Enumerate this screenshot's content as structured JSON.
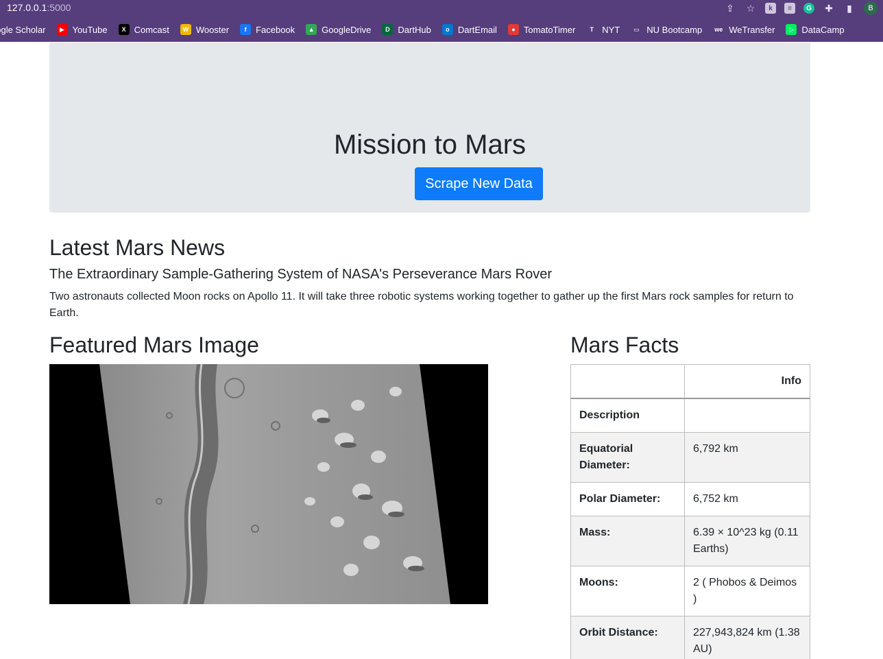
{
  "browser": {
    "url_host": "127.0.0.1",
    "url_port": ":5000",
    "avatar_letter": "B"
  },
  "bookmarks": [
    {
      "label": "oogle Scholar",
      "icon": "google-scholar-icon",
      "color": "#4285f4",
      "glyph": ""
    },
    {
      "label": "YouTube",
      "icon": "youtube-icon",
      "color": "#ff0000",
      "glyph": "▶"
    },
    {
      "label": "Comcast",
      "icon": "x-icon",
      "color": "#000000",
      "glyph": "X"
    },
    {
      "label": "Wooster",
      "icon": "wooster-icon",
      "color": "#f2b705",
      "glyph": "W"
    },
    {
      "label": "Facebook",
      "icon": "facebook-icon",
      "color": "#1877f2",
      "glyph": "f"
    },
    {
      "label": "GoogleDrive",
      "icon": "google-drive-icon",
      "color": "#34a853",
      "glyph": "▲"
    },
    {
      "label": "DartHub",
      "icon": "darthub-icon",
      "color": "#00693e",
      "glyph": "D"
    },
    {
      "label": "DartEmail",
      "icon": "outlook-icon",
      "color": "#0078d4",
      "glyph": "o"
    },
    {
      "label": "TomatoTimer",
      "icon": "tomato-icon",
      "color": "#e53935",
      "glyph": "●"
    },
    {
      "label": "NYT",
      "icon": "nyt-icon",
      "color": "#563d7c",
      "glyph": "T"
    },
    {
      "label": "NU Bootcamp",
      "icon": "folder-icon",
      "color": "#563d7c",
      "glyph": "▭"
    },
    {
      "label": "WeTransfer",
      "icon": "wetransfer-icon",
      "color": "#563d7c",
      "glyph": "we"
    },
    {
      "label": "DataCamp",
      "icon": "datacamp-icon",
      "color": "#03ef62",
      "glyph": "▷"
    }
  ],
  "jumbotron": {
    "title": "Mission to Mars",
    "button_label": "Scrape New Data"
  },
  "news": {
    "heading": "Latest Mars News",
    "title": "The Extraordinary Sample-Gathering System of NASA's Perseverance Mars Rover",
    "paragraph": "Two astronauts collected Moon rocks on Apollo 11. It will take three robotic systems working together to gather up the first Mars rock samples for return to Earth."
  },
  "featured": {
    "heading": "Featured Mars Image"
  },
  "facts": {
    "heading": "Mars Facts",
    "column_header": "Info",
    "rows": [
      {
        "label": "Description",
        "value": ""
      },
      {
        "label": "Equatorial Diameter:",
        "value": "6,792 km"
      },
      {
        "label": "Polar Diameter:",
        "value": "6,752 km"
      },
      {
        "label": "Mass:",
        "value": "6.39 × 10^23 kg (0.11 Earths)"
      },
      {
        "label": "Moons:",
        "value": "2 ( Phobos & Deimos )"
      },
      {
        "label": "Orbit Distance:",
        "value": "227,943,824 km (1.38 AU)"
      }
    ]
  }
}
